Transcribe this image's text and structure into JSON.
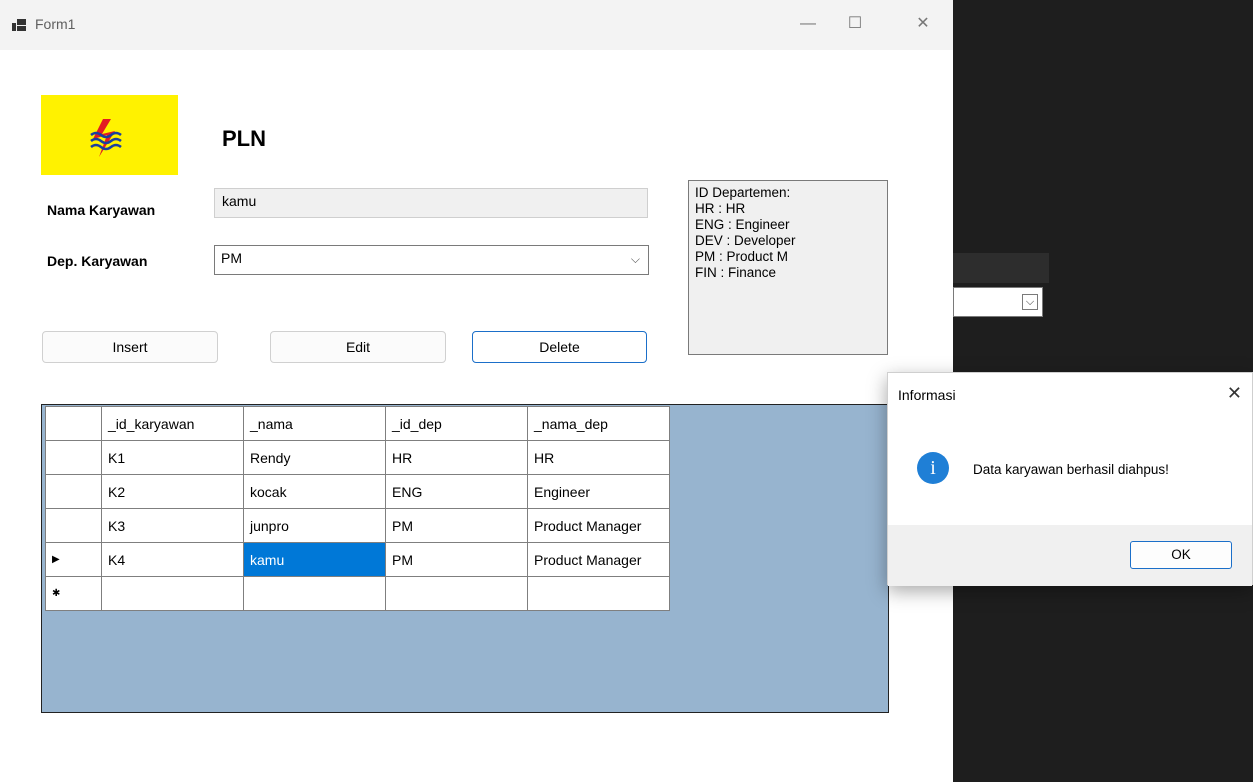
{
  "window": {
    "title": "Form1",
    "icon": "app-icon"
  },
  "brand": {
    "name": "PLN",
    "logo": "pln-lightning-logo"
  },
  "form": {
    "name_label": "Nama Karyawan",
    "name_value": "kamu",
    "dept_label": "Dep. Karyawan",
    "dept_value": "PM"
  },
  "info_lines": "ID Departemen:\nHR : HR\nENG : Engineer\nDEV : Developer\nPM : Product M\nFIN : Finance",
  "buttons": {
    "insert": "Insert",
    "edit": "Edit",
    "delete": "Delete"
  },
  "grid": {
    "columns": [
      "_id_karyawan",
      "_nama",
      "_id_dep",
      "_nama_dep"
    ],
    "rows": [
      [
        "K1",
        "Rendy",
        "HR",
        "HR"
      ],
      [
        "K2",
        "kocak",
        "ENG",
        "Engineer"
      ],
      [
        "K3",
        "junpro",
        "PM",
        "Product Manager"
      ],
      [
        "K4",
        "kamu",
        "PM",
        "Product Manager"
      ]
    ],
    "current_row_marker": "▶",
    "new_row_marker": "✱"
  },
  "dialog": {
    "title": "Informasi",
    "message": "Data karyawan berhasil diahpus!",
    "ok": "OK",
    "icon": "info-icon"
  },
  "colors": {
    "grid_background": "#97b4cf",
    "selection": "#0078d7",
    "logo_background": "#fff200",
    "accent": "#1b6fc9"
  }
}
